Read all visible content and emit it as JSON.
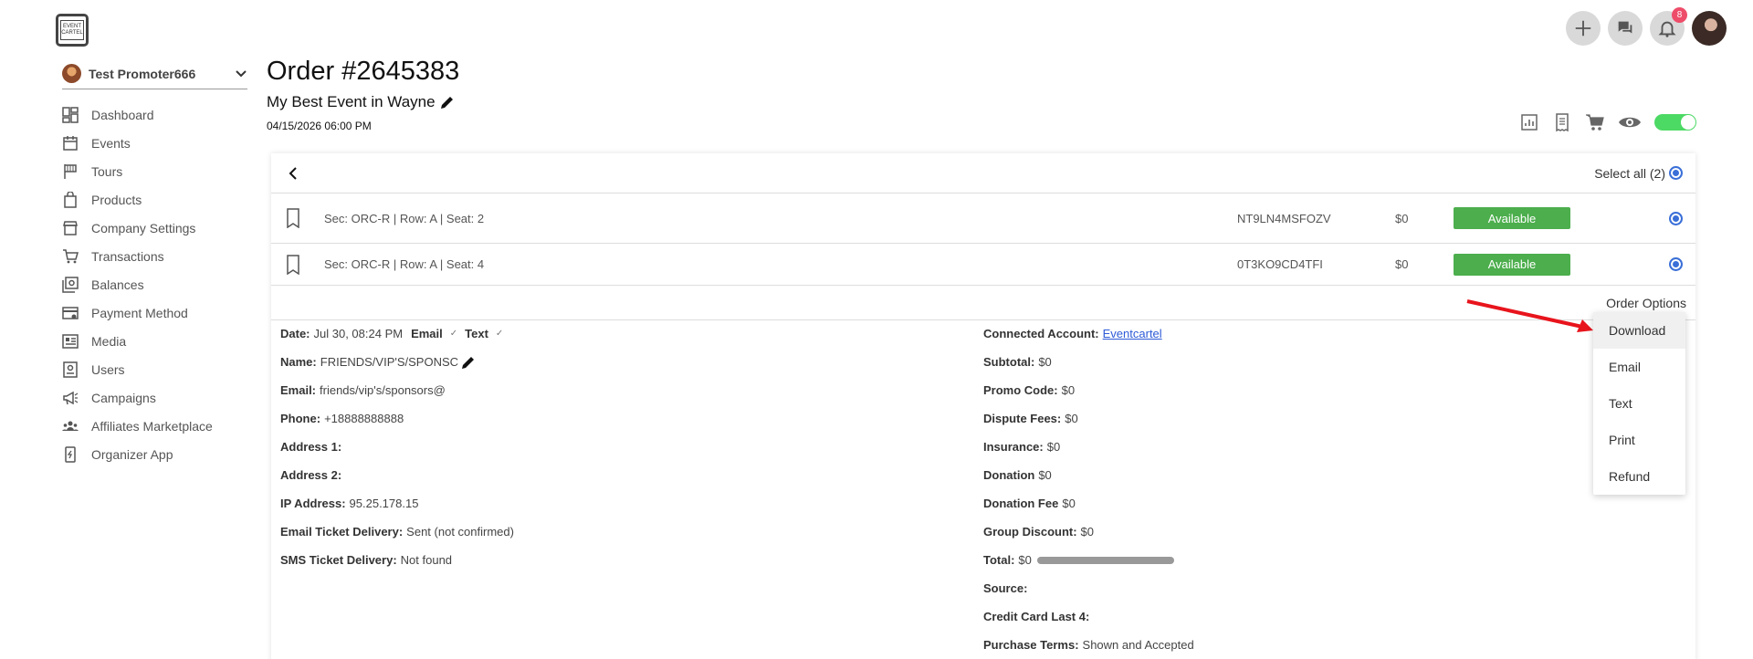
{
  "brand": {
    "logo_text": "EVENT CARTEL"
  },
  "topbar": {
    "notifications_count": "8"
  },
  "sidebar": {
    "promoter_name": "Test Promoter666",
    "items": [
      {
        "label": "Dashboard",
        "icon": "dashboard-icon"
      },
      {
        "label": "Events",
        "icon": "calendar-icon"
      },
      {
        "label": "Tours",
        "icon": "flag-icon"
      },
      {
        "label": "Products",
        "icon": "bag-icon"
      },
      {
        "label": "Company Settings",
        "icon": "store-icon"
      },
      {
        "label": "Transactions",
        "icon": "cart-icon"
      },
      {
        "label": "Balances",
        "icon": "money-icon"
      },
      {
        "label": "Payment Method",
        "icon": "card-icon"
      },
      {
        "label": "Media",
        "icon": "media-icon"
      },
      {
        "label": "Users",
        "icon": "user-icon"
      },
      {
        "label": "Campaigns",
        "icon": "megaphone-icon"
      },
      {
        "label": "Affiliates Marketplace",
        "icon": "group-icon"
      },
      {
        "label": "Organizer App",
        "icon": "phone-icon"
      }
    ]
  },
  "order": {
    "title": "Order #2645383",
    "event_name": "My Best Event in Wayne",
    "event_date": "04/15/2026 06:00 PM",
    "select_all": "Select all (2)",
    "order_options": "Order Options",
    "tickets": [
      {
        "seat": "Sec: ORC-R | Row: A | Seat: 2",
        "code": "NT9LN4MSFOZV",
        "price": "$0",
        "status": "Available"
      },
      {
        "seat": "Sec: ORC-R | Row: A | Seat: 4",
        "code": "0T3KO9CD4TFI",
        "price": "$0",
        "status": "Available"
      }
    ]
  },
  "details_left": {
    "date_label": "Date:",
    "date_value": "Jul 30, 08:24 PM",
    "email_link": "Email",
    "text_link": "Text",
    "name_label": "Name:",
    "name_value": "FRIENDS/VIP'S/SPONSC",
    "email_label": "Email:",
    "email_value": "friends/vip's/sponsors@",
    "phone_label": "Phone:",
    "phone_value": "+18888888888",
    "address1_label": "Address 1:",
    "address2_label": "Address 2:",
    "ip_label": "IP Address:",
    "ip_value": "95.25.178.15",
    "email_delivery_label": "Email Ticket Delivery:",
    "email_delivery_value": "Sent (not confirmed)",
    "sms_delivery_label": "SMS Ticket Delivery:",
    "sms_delivery_value": "Not found"
  },
  "details_right": {
    "account_label": "Connected Account:",
    "account_value": "Eventcartel",
    "subtotal_label": "Subtotal:",
    "subtotal_value": "$0",
    "promo_label": "Promo Code:",
    "promo_value": "$0",
    "dispute_label": "Dispute Fees:",
    "dispute_value": "$0",
    "insurance_label": "Insurance:",
    "insurance_value": "$0",
    "donation_label": "Donation",
    "donation_value": "$0",
    "donation_fee_label": "Donation Fee",
    "donation_fee_value": "$0",
    "group_label": "Group Discount:",
    "group_value": "$0",
    "total_label": "Total:",
    "total_value": "$0",
    "source_label": "Source:",
    "cc_label": "Credit Card Last 4:",
    "terms_label": "Purchase Terms:",
    "terms_value": "Shown and Accepted"
  },
  "dropdown": {
    "items": [
      "Download",
      "Email",
      "Text",
      "Print",
      "Refund"
    ]
  },
  "colors": {
    "accent": "#3a6fd8",
    "available": "#4cae4c",
    "toggle": "#4cd964",
    "annotation": "#e8141c"
  }
}
